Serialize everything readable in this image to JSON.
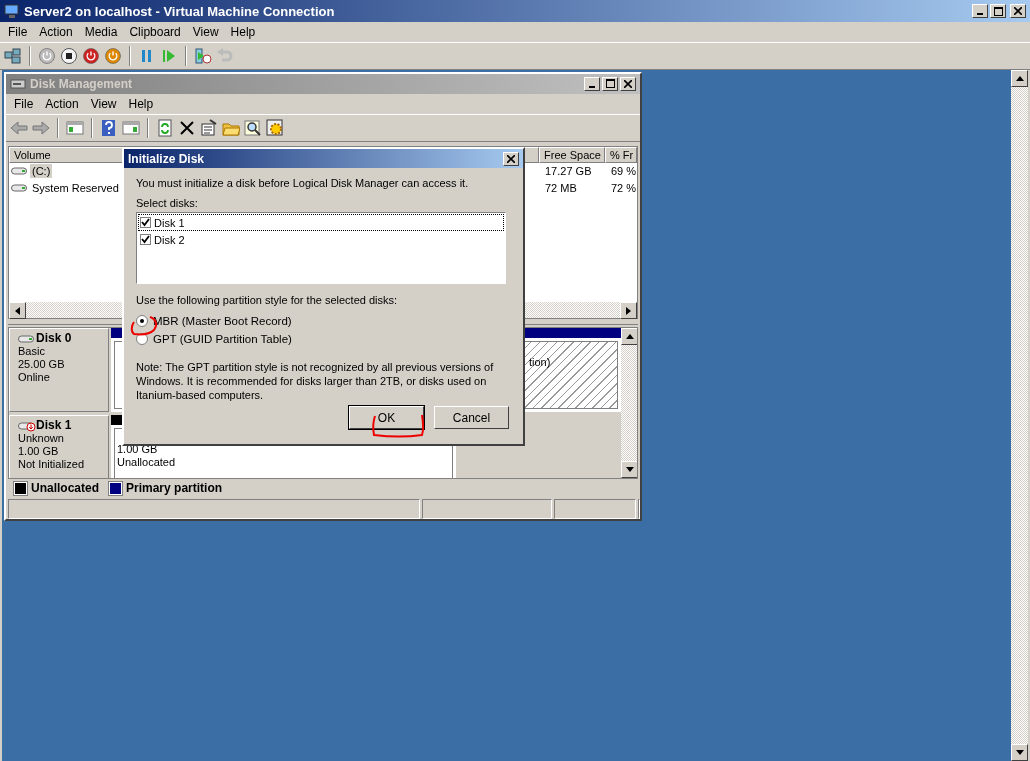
{
  "window": {
    "title": "Server2 on localhost - Virtual Machine Connection"
  },
  "menu": [
    "File",
    "Action",
    "Media",
    "Clipboard",
    "View",
    "Help"
  ],
  "disk_management": {
    "title": "Disk Management",
    "menu": [
      "File",
      "Action",
      "View",
      "Help"
    ],
    "volumes": {
      "columns": [
        "Volume",
        "Free Space",
        "% Fr"
      ],
      "rows": [
        {
          "volume": "(C:)",
          "free_space": "17.27 GB",
          "percent_free": "69 %",
          "selected": true
        },
        {
          "volume": "System Reserved",
          "free_space": "72 MB",
          "percent_free": "72 %",
          "selected": false
        }
      ]
    },
    "disks": [
      {
        "name": "Disk 0",
        "type": "Basic",
        "size": "25.00 GB",
        "status": "Online",
        "kind": "online",
        "partitions": [
          {
            "kind": "primary",
            "selected": false
          },
          {
            "kind": "primary",
            "selected": true,
            "lines": [
              "tion)"
            ]
          }
        ]
      },
      {
        "name": "Disk 1",
        "type": "Unknown",
        "size": "1.00 GB",
        "status": "Not Initialized",
        "kind": "uninitialized",
        "partitions": [
          {
            "kind": "unallocated",
            "selected": false,
            "lines": [
              "1.00 GB",
              "Unallocated"
            ]
          }
        ]
      }
    ],
    "legend": [
      {
        "label": "Unallocated",
        "color": "#000000"
      },
      {
        "label": "Primary partition",
        "color": "#000080"
      }
    ]
  },
  "dialog": {
    "title": "Initialize Disk",
    "message": "You must initialize a disk before Logical Disk Manager can access it.",
    "select_label": "Select disks:",
    "disks": [
      {
        "label": "Disk 1",
        "checked": true,
        "selected": true
      },
      {
        "label": "Disk 2",
        "checked": true,
        "selected": false
      }
    ],
    "style_label": "Use the following partition style for the selected disks:",
    "styles": [
      {
        "label": "MBR (Master Boot Record)",
        "selected": true
      },
      {
        "label": "GPT (GUID Partition Table)",
        "selected": false
      }
    ],
    "note": "Note: The GPT partition style is not recognized by all previous versions of Windows. It is recommended for disks larger than 2TB, or disks used on Itanium-based computers.",
    "buttons": [
      {
        "label": "OK",
        "default": true
      },
      {
        "label": "Cancel",
        "default": false
      }
    ]
  }
}
